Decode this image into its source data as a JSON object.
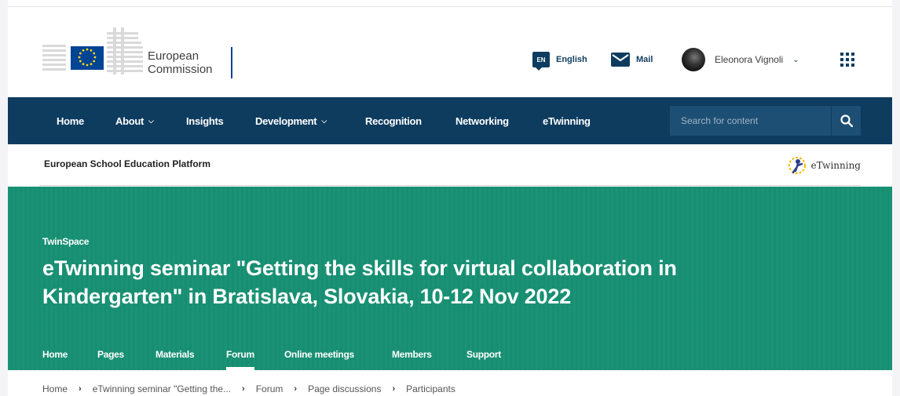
{
  "header": {
    "logo_line1": "European",
    "logo_line2": "Commission",
    "language_code": "EN",
    "language_label": "English",
    "mail_label": "Mail",
    "user_name": "Eleonora Vignoli"
  },
  "main_nav": {
    "items": [
      {
        "label": "Home"
      },
      {
        "label": "About",
        "dropdown": true
      },
      {
        "label": "Insights"
      },
      {
        "label": "Development",
        "dropdown": true
      },
      {
        "label": "Recognition"
      },
      {
        "label": "Networking"
      },
      {
        "label": "eTwinning"
      }
    ],
    "search_placeholder": "Search for content"
  },
  "platform": {
    "title": "European School Education Platform",
    "etwinning_logo_text": "eTwinning"
  },
  "hero": {
    "kicker": "TwinSpace",
    "title": "eTwinning seminar \"Getting the skills for virtual collaboration in Kindergarten\" in Bratislava, Slovakia, 10-12 Nov 2022",
    "tabs": [
      {
        "label": "Home"
      },
      {
        "label": "Pages"
      },
      {
        "label": "Materials"
      },
      {
        "label": "Forum",
        "active": true
      },
      {
        "label": "Online meetings"
      },
      {
        "label": "Members"
      },
      {
        "label": "Support"
      }
    ]
  },
  "breadcrumb": [
    "Home",
    "eTwinning seminar \"Getting the...",
    "Forum",
    "Page discussions",
    "Participants"
  ],
  "colors": {
    "nav_bg": "#0e3c5f",
    "hero_bg": "#179073",
    "ec_blue": "#004494",
    "ec_yellow": "#ffd617"
  }
}
